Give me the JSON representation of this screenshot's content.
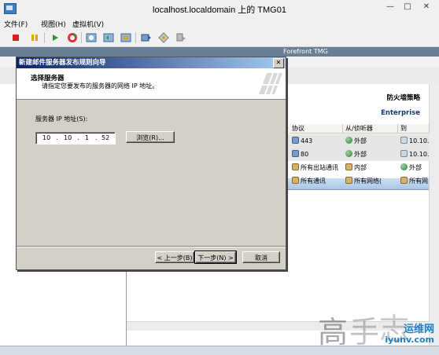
{
  "window": {
    "title": "localhost.localdomain 上的 TMG01",
    "minimize_glyph": "—",
    "maximize_glyph": "□",
    "close_glyph": "✕"
  },
  "menu": {
    "file": "文件(F)",
    "view": "视图(H)",
    "vm": "虚拟机(V)"
  },
  "toolbar": {
    "icons": [
      "stop-icon",
      "pause-icon",
      "play-icon",
      "reset-icon",
      "snapshot-icon",
      "revert-icon",
      "manage-snapshots-icon",
      "send-keys-icon",
      "install-tools-icon",
      "migrate-icon"
    ],
    "colors": {
      "stop": "#d62020",
      "pause": "#e8a300",
      "play": "#2a9a2a"
    }
  },
  "console": {
    "vm_title": "Forefront TMG",
    "header_right_1": "防火墙策略",
    "header_right_2": "Enterprise",
    "columns": [
      "协议",
      "从/侦听器",
      "到"
    ],
    "rows": [
      {
        "protocol": "443",
        "from": "外部",
        "to": "10.10.",
        "style": "gray"
      },
      {
        "protocol": "80",
        "from": "外部",
        "to": "10.10.",
        "style": "gray"
      },
      {
        "protocol": "所有出站通讯",
        "from": "内部",
        "to": "外部",
        "style": "white"
      },
      {
        "protocol": "所有通讯",
        "from": "所有网络(",
        "to": "所有网",
        "style": "white"
      }
    ]
  },
  "dialog": {
    "title": "新建邮件服务器发布规则向导",
    "close_glyph": "✕",
    "heading": "选择服务器",
    "subheading": "请指定您要发布的服务器的网络 IP 地址。",
    "ip_label": "服务器 IP 地址(S):",
    "ip_octets": [
      "10",
      "10",
      "1",
      "52"
    ],
    "ip_dot": ".",
    "browse_button": "浏览(R)...",
    "back_button": "< 上一步(B)",
    "next_button": "下一步(N) >",
    "cancel_button": "取消"
  },
  "watermark": {
    "hanzi": [
      "高",
      "手",
      "志"
    ],
    "site": "运维网",
    "url": "iyunv.com"
  }
}
